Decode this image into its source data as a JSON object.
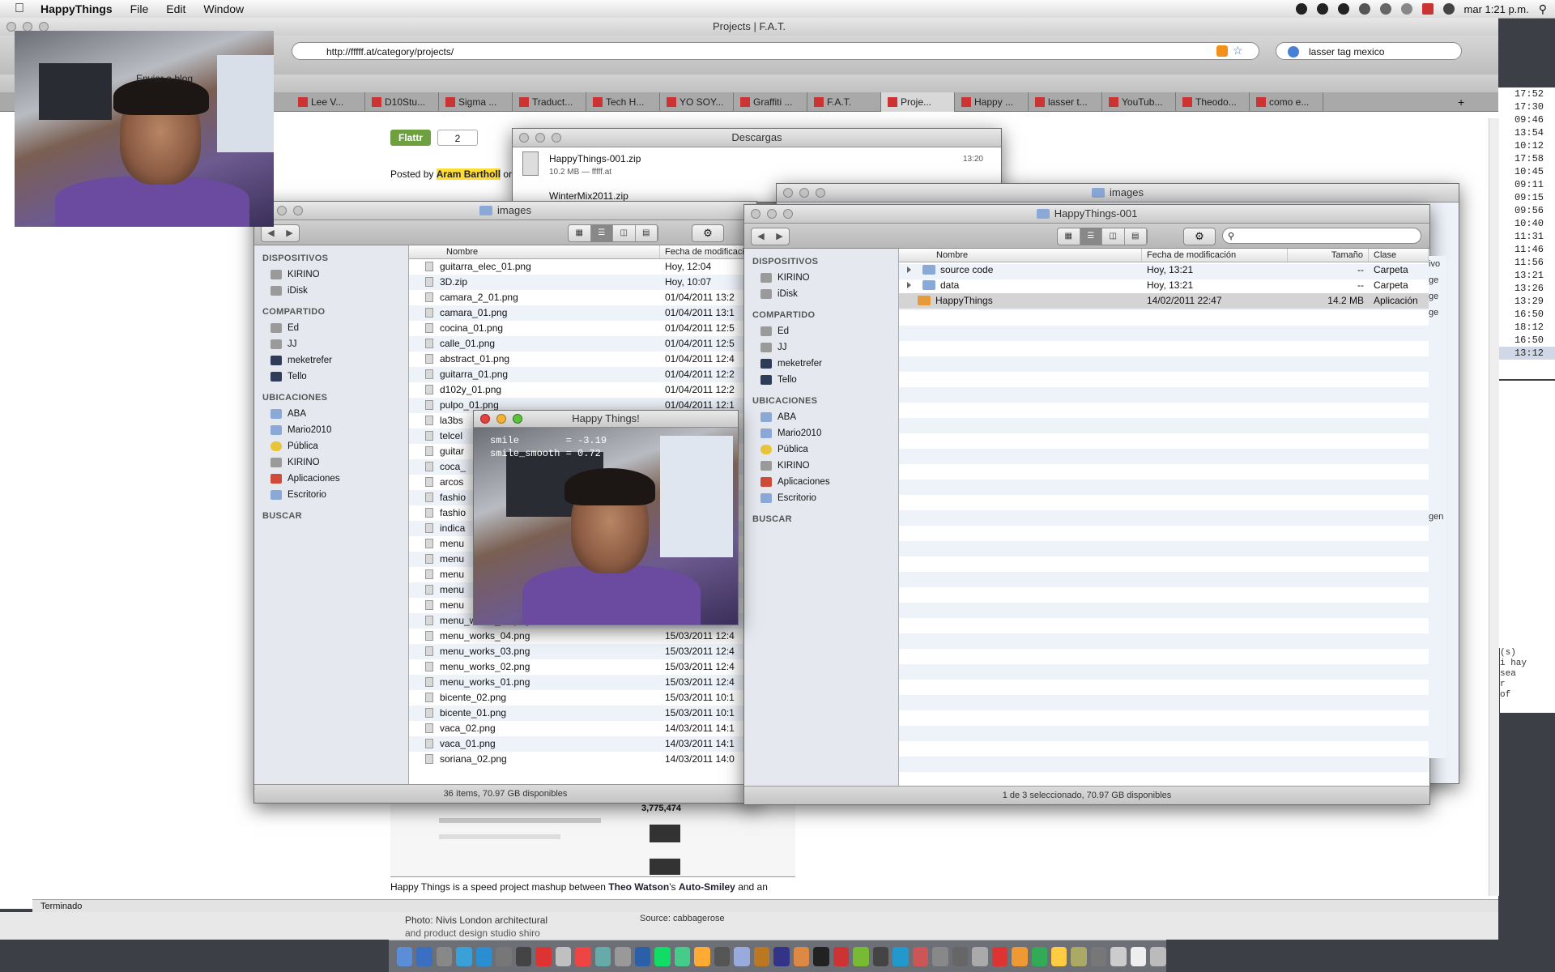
{
  "menubar": {
    "app": "HappyThings",
    "menus": [
      "File",
      "Edit",
      "Window"
    ],
    "clock": "mar 1:21 p.m."
  },
  "browser": {
    "title": "Projects | F.A.T.",
    "url": "http://fffff.at/category/projects/",
    "search": "lasser tag mexico",
    "tabs": [
      "Lee V...",
      "D10Stu...",
      "Sigma ...",
      "Traduct...",
      "Tech H...",
      "YO SOY...",
      "Graffiti ...",
      "F.A.T.",
      "Proje...",
      "Happy ...",
      "lasser t...",
      "YouTub...",
      "Theodo...",
      "como e..."
    ],
    "active_tab": "Proje...",
    "bookmark_labels": [
      "Enviar a blog"
    ],
    "status": "Terminado",
    "page": {
      "flattr": "Flattr",
      "flattr_count": "2",
      "posted_by": "Posted by",
      "author": "Aram Bartholl",
      "posted_tail": "or",
      "body_prefix": "Happy Things is a speed project mashup between",
      "theo": "Theo Watson",
      "apos": "'s",
      "autosmiley": "Auto-Smiley",
      "body_tail": "and an",
      "photo_credit": "Photo: Nivis London architectural",
      "photo_credit2": "and product design studio shiro",
      "source": "Source: cabbagerose",
      "yt_count": "3,775,474"
    }
  },
  "timecol": [
    "17:52",
    "17:30",
    "09:46",
    "13:54",
    "10:12",
    "17:58",
    "10:45",
    "09:11",
    "09:15",
    "09:56",
    "10:40",
    "11:31",
    "11:46",
    "11:56",
    "13:21",
    "13:26",
    "13:29",
    "16:50",
    "18:12",
    "16:50",
    "13:12"
  ],
  "descargas": {
    "title": "Descargas",
    "item1_name": "HappyThings-001.zip",
    "item1_meta": "10.2 MB — fffff.at",
    "item1_time": "13:20",
    "item2_name": "WinterMix2011.zip"
  },
  "finder_images_back": {
    "title": "images"
  },
  "finder_images": {
    "title": "images",
    "sidebar": {
      "devices_h": "DISPOSITIVOS",
      "devices": [
        "KIRINO",
        "iDisk"
      ],
      "shared_h": "COMPARTIDO",
      "shared": [
        "Ed",
        "JJ",
        "meketrefer",
        "Tello"
      ],
      "places_h": "UBICACIONES",
      "places": [
        "ABA",
        "Mario2010",
        "Pública",
        "KIRINO",
        "Aplicaciones",
        "Escritorio"
      ],
      "search_h": "BUSCAR"
    },
    "col_name": "Nombre",
    "col_date": "Fecha de modificación",
    "rows": [
      [
        "guitarra_elec_01.png",
        "Hoy, 12:04"
      ],
      [
        "3D.zip",
        "Hoy, 10:07"
      ],
      [
        "camara_2_01.png",
        "01/04/2011 13:2"
      ],
      [
        "camara_01.png",
        "01/04/2011 13:1"
      ],
      [
        "cocina_01.png",
        "01/04/2011 12:5"
      ],
      [
        "calle_01.png",
        "01/04/2011 12:5"
      ],
      [
        "abstract_01.png",
        "01/04/2011 12:4"
      ],
      [
        "guitarra_01.png",
        "01/04/2011 12:2"
      ],
      [
        "d102y_01.png",
        "01/04/2011 12:2"
      ],
      [
        "pulpo_01.png",
        "01/04/2011 12:1"
      ],
      [
        "la3bs",
        ""
      ],
      [
        "telcel",
        ""
      ],
      [
        "guitar",
        ""
      ],
      [
        "coca_",
        ""
      ],
      [
        "arcos",
        ""
      ],
      [
        "fashio",
        ""
      ],
      [
        "fashio",
        ""
      ],
      [
        "indica",
        ""
      ],
      [
        "menu",
        ""
      ],
      [
        "menu",
        ""
      ],
      [
        "menu",
        ""
      ],
      [
        "menu",
        ""
      ],
      [
        "menu",
        ""
      ],
      [
        "menu_works_05.png",
        ""
      ],
      [
        "menu_works_04.png",
        "15/03/2011 12:4"
      ],
      [
        "menu_works_03.png",
        "15/03/2011 12:4"
      ],
      [
        "menu_works_02.png",
        "15/03/2011 12:4"
      ],
      [
        "menu_works_01.png",
        "15/03/2011 12:4"
      ],
      [
        "bicente_02.png",
        "15/03/2011 10:1"
      ],
      [
        "bicente_01.png",
        "15/03/2011 10:1"
      ],
      [
        "vaca_02.png",
        "14/03/2011 14:1"
      ],
      [
        "vaca_01.png",
        "14/03/2011 14:1"
      ],
      [
        "soriana_02.png",
        "14/03/2011 14:0"
      ]
    ],
    "status": "36 ítems, 70.97 GB disponibles"
  },
  "finder_happy": {
    "title": "HappyThings-001",
    "sidebar": {
      "devices_h": "DISPOSITIVOS",
      "devices": [
        "KIRINO",
        "iDisk"
      ],
      "shared_h": "COMPARTIDO",
      "shared": [
        "Ed",
        "JJ",
        "meketrefer",
        "Tello"
      ],
      "places_h": "UBICACIONES",
      "places": [
        "ABA",
        "Mario2010",
        "Pública",
        "KIRINO",
        "Aplicaciones",
        "Escritorio"
      ],
      "search_h": "BUSCAR"
    },
    "col_name": "Nombre",
    "col_date": "Fecha de modificación",
    "col_size": "Tamaño",
    "col_kind": "Clase",
    "rows": [
      {
        "name": "source code",
        "date": "Hoy, 13:21",
        "size": "--",
        "kind": "Carpeta"
      },
      {
        "name": "data",
        "date": "Hoy, 13:21",
        "size": "--",
        "kind": "Carpeta"
      },
      {
        "name": "HappyThings",
        "date": "14/02/2011 22:47",
        "size": "14.2 MB",
        "kind": "Aplicación"
      }
    ],
    "status": "1 de 3 seleccionado, 70.97 GB disponibles",
    "right_fragments": [
      "ivo",
      "ge",
      "gen"
    ]
  },
  "happy_window": {
    "title": "Happy Things!",
    "line1": "smile        = -3.19",
    "line2": "smile_smooth = 0.72"
  },
  "right_text": [
    "(s)",
    "i hay",
    "sea",
    "r",
    "of"
  ]
}
